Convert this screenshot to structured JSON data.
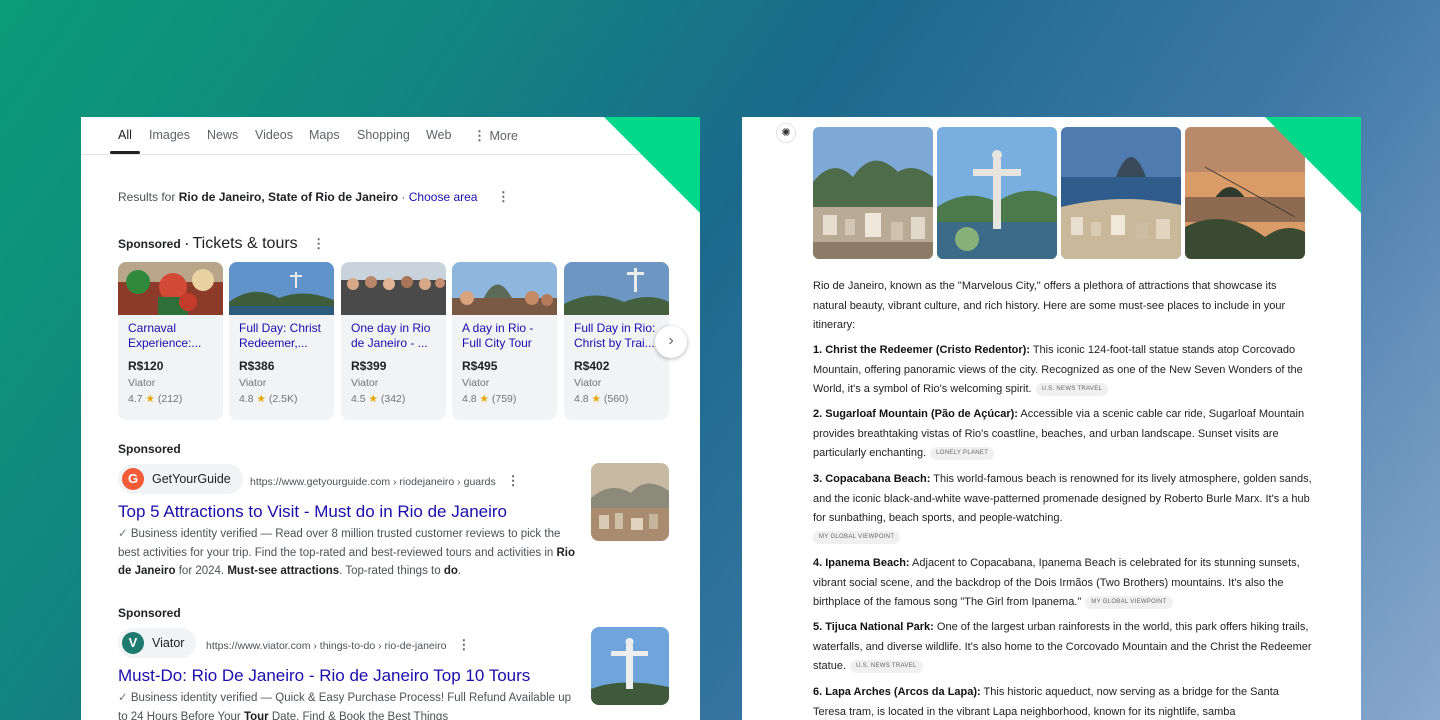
{
  "search": {
    "tabs": [
      "All",
      "Images",
      "News",
      "Videos",
      "Maps",
      "Shopping",
      "Web",
      "More"
    ],
    "active_tab": "All",
    "results_for_prefix": "Results for",
    "results_for_location": "Rio de Janeiro, State of Rio de Janeiro",
    "results_for_sep": " · ",
    "choose_area": "Choose area",
    "sponsored_label": "Sponsored",
    "tickets_title": "Tickets & tours",
    "cards": [
      {
        "title": "Carnaval Experience:...",
        "price": "R$120",
        "vendor": "Viator",
        "rating": "4.7",
        "reviews": "(212)"
      },
      {
        "title": "Full Day: Christ Redeemer,...",
        "price": "R$386",
        "vendor": "Viator",
        "rating": "4.8",
        "reviews": "(2.5K)"
      },
      {
        "title": "One day in Rio de Janeiro - ...",
        "price": "R$399",
        "vendor": "Viator",
        "rating": "4.5",
        "reviews": "(342)"
      },
      {
        "title": "A day in Rio - Full City Tour",
        "price": "R$495",
        "vendor": "Viator",
        "rating": "4.8",
        "reviews": "(759)"
      },
      {
        "title": "Full Day in Rio: Christ by Trai...",
        "price": "R$402",
        "vendor": "Viator",
        "rating": "4.8",
        "reviews": "(560)"
      }
    ],
    "ads": [
      {
        "sponsored": "Sponsored",
        "advertiser": "GetYourGuide",
        "logo_letter": "G",
        "url": "https://www.getyourguide.com › riodejaneiro › guards",
        "title": "Top 5 Attractions to Visit - Must do in Rio de Janeiro",
        "verified": "Business identity verified",
        "desc_1": " — Read over 8 million trusted customer reviews to pick the best activities for your trip. Find the top-rated and best-reviewed tours and activities in ",
        "desc_b1": "Rio de Janeiro",
        "desc_2": " for 2024. ",
        "desc_b2": "Must-see attractions",
        "desc_3": ". Top-rated things to ",
        "desc_b3": "do",
        "desc_4": "."
      },
      {
        "sponsored": "Sponsored",
        "advertiser": "Viator",
        "logo_letter": "V",
        "url": "https://www.viator.com › things-to-do › rio-de-janeiro",
        "title": "Must-Do: Rio De Janeiro - Rio de Janeiro Top 10 Tours",
        "verified": "Business identity verified",
        "desc_1": " — Quick & Easy Purchase Process! Full Refund Available up to 24 Hours Before Your ",
        "desc_b1": "Tour",
        "desc_2": " Date. Find & Book the Best Things"
      }
    ]
  },
  "chatgpt": {
    "intro": "Rio de Janeiro, known as the \"Marvelous City,\" offers a plethora of attractions that showcase its natural beauty, vibrant culture, and rich history. Here are some must-see places to include in your itinerary:",
    "items": [
      {
        "heading": "1. Christ the Redeemer (Cristo Redentor):",
        "body": " This iconic 124-foot-tall statue stands atop Corcovado Mountain, offering panoramic views of the city. Recognized as one of the New Seven Wonders of the World, it's a symbol of Rio's welcoming spirit.",
        "source": "U.S. NEWS TRAVEL"
      },
      {
        "heading": "2. Sugarloaf Mountain (Pão de Açúcar):",
        "body": " Accessible via a scenic cable car ride, Sugarloaf Mountain provides breathtaking vistas of Rio's coastline, beaches, and urban landscape. Sunset visits are particularly enchanting.",
        "source": "LONELY PLANET"
      },
      {
        "heading": "3. Copacabana Beach:",
        "body": " This world-famous beach is renowned for its lively atmosphere, golden sands, and the iconic black-and-white wave-patterned promenade designed by Roberto Burle Marx. It's a hub for sunbathing, beach sports, and people-watching.",
        "source": "MY GLOBAL VIEWPOINT"
      },
      {
        "heading": "4. Ipanema Beach:",
        "body": " Adjacent to Copacabana, Ipanema Beach is celebrated for its stunning sunsets, vibrant social scene, and the backdrop of the Dois Irmãos (Two Brothers) mountains. It's also the birthplace of the famous song \"The Girl from Ipanema.\"",
        "source": "MY GLOBAL VIEWPOINT"
      },
      {
        "heading": "5. Tijuca National Park:",
        "body": " One of the largest urban rainforests in the world, this park offers hiking trails, waterfalls, and diverse wildlife. It's also home to the Corcovado Mountain and the Christ the Redeemer statue.",
        "source": "U.S. NEWS TRAVEL"
      },
      {
        "heading": "6. Lapa Arches (Arcos da Lapa):",
        "body": " This historic aqueduct, now serving as a bridge for the Santa Teresa tram, is located in the vibrant Lapa neighborhood, known for its nightlife, samba",
        "source": ""
      }
    ]
  },
  "colors": {
    "accent_green": "#00d98a",
    "link_blue": "#1a0dab",
    "star": "#e7a600"
  }
}
